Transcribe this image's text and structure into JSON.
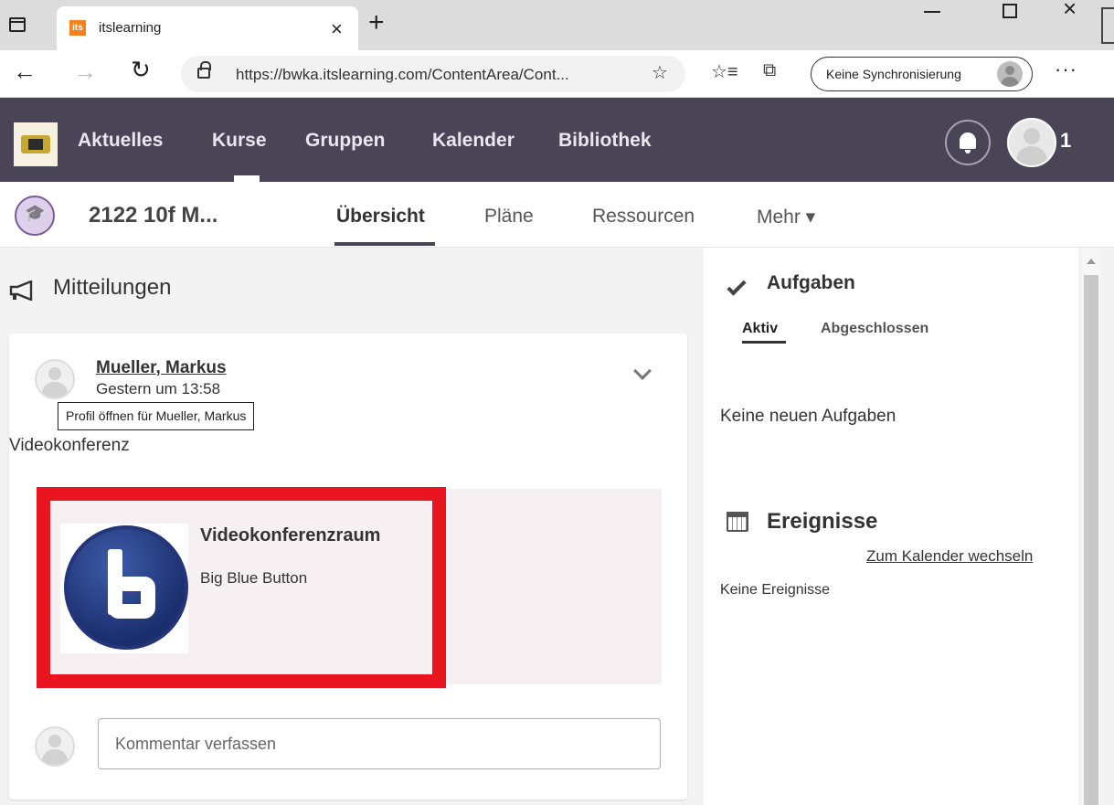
{
  "browser": {
    "tab_title": "itslearning",
    "tab_favicon_text": "its",
    "url": "https://bwka.itslearning.com/ContentArea/Cont...",
    "sync_label": "Keine Synchronisierung",
    "icons": {
      "sidebar": "tab-sidebar-icon",
      "close_tab": "close-icon",
      "new_tab": "plus-icon",
      "back": "arrow-left-icon",
      "forward": "arrow-right-icon",
      "reload": "reload-icon",
      "lock": "lock-icon",
      "add_favorite": "star-plus-icon",
      "favorites": "favorites-list-icon",
      "collections": "collections-icon",
      "more": "ellipsis-icon"
    }
  },
  "topnav": {
    "items": [
      "Aktuelles",
      "Kurse",
      "Gruppen",
      "Kalender",
      "Bibliothek"
    ],
    "active_item": "Kurse",
    "notification_count": "1",
    "background_color": "#4a4457"
  },
  "course": {
    "title": "2122 10f M...",
    "tabs": [
      "Übersicht",
      "Pläne",
      "Ressourcen",
      "Mehr ▾"
    ],
    "active_tab": "Übersicht"
  },
  "announcements": {
    "title": "Mitteilungen",
    "post": {
      "author": "Mueller, Markus",
      "time": "Gestern um 13:58",
      "tooltip": "Profil öffnen für Mueller, Markus",
      "body": "Videokonferenz",
      "link_card": {
        "title": "Videokonferenzraum",
        "subtitle": "Big Blue Button",
        "highlight_color": "#e8141f"
      },
      "comment_placeholder": "Kommentar verfassen"
    }
  },
  "tasks": {
    "title": "Aufgaben",
    "tabs": [
      "Aktiv",
      "Abgeschlossen"
    ],
    "active_tab": "Aktiv",
    "empty_text": "Keine neuen Aufgaben"
  },
  "events": {
    "title": "Ereignisse",
    "calendar_link": "Zum Kalender wechseln",
    "empty_text": "Keine Ereignisse"
  }
}
